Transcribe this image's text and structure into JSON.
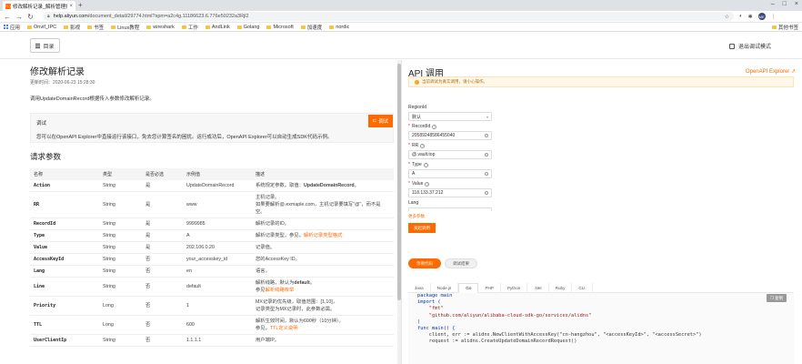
{
  "browser": {
    "tab_title": "修改解析记录_解析管理接",
    "tab_favicon": "C-)",
    "url_host": "help.aliyun.com",
    "url_path": "/document_detail/29774.html?spm=a2c4g.11186623.6.776e50232a3Rjl2",
    "bookmarks": [
      "应用",
      "Onvif_IPC",
      "影视",
      "书签",
      "Linux教程",
      "wireshark",
      "工作",
      "AndLink",
      "Golang",
      "Microsoft",
      "加速度",
      "nordic"
    ],
    "bookmarks_other": "其他书签",
    "avatar": "ME"
  },
  "header": {
    "toc_label": "目录",
    "exit_debug_label": "退出调试模式"
  },
  "doc": {
    "title": "修改解析记录",
    "updated": "更新时间：2020-06-23 15:28:30",
    "description": "调用UpdateDomainRecord根据传入参数修改解析记录。",
    "debug_heading": "调试",
    "debug_body": "您可以在OpenAPI Explorer中直接运行该接口，免去您计算签名的困扰。运行成功后，OpenAPI Explorer可以自动生成SDK代码示例。",
    "debug_button": "调试",
    "params_title": "请求参数",
    "columns": [
      "名称",
      "类型",
      "是否必选",
      "示例值",
      "描述"
    ],
    "rows": [
      {
        "name": "Action",
        "type": "String",
        "required": "是",
        "example": "UpdateDomainRecord",
        "desc_pre": "系统规定参数。取值：",
        "desc_bold": "UpdateDomainRecord",
        "desc_link": "",
        "desc_post": "。"
      },
      {
        "name": "RR",
        "type": "String",
        "required": "是",
        "example": "www",
        "desc_pre": "主机记录。\n如果要解析@.exmaple.com，主机记录要填写\"@\"，而不是空。",
        "desc_bold": "",
        "desc_link": "",
        "desc_post": ""
      },
      {
        "name": "RecordId",
        "type": "String",
        "required": "是",
        "example": "9999985",
        "desc_pre": "解析记录的ID。",
        "desc_bold": "",
        "desc_link": "",
        "desc_post": ""
      },
      {
        "name": "Type",
        "type": "String",
        "required": "是",
        "example": "A",
        "desc_pre": "解析记录类型，参见",
        "desc_bold": "",
        "desc_link": "解析记录类型格式",
        "desc_post": "。"
      },
      {
        "name": "Value",
        "type": "String",
        "required": "是",
        "example": "202.106.0.20",
        "desc_pre": "记录值。",
        "desc_bold": "",
        "desc_link": "",
        "desc_post": ""
      },
      {
        "name": "AccessKeyId",
        "type": "String",
        "required": "否",
        "example": "your_accesskey_id",
        "desc_pre": "您的AccessKey ID。",
        "desc_bold": "",
        "desc_link": "",
        "desc_post": ""
      },
      {
        "name": "Lang",
        "type": "String",
        "required": "否",
        "example": "en",
        "desc_pre": "语言。",
        "desc_bold": "",
        "desc_link": "",
        "desc_post": ""
      },
      {
        "name": "Line",
        "type": "String",
        "required": "否",
        "example": "default",
        "desc_pre": "解析线路，默认为",
        "desc_bold": "default",
        "desc_link": "解析线路枚举",
        "desc_post": "。\n参见"
      },
      {
        "name": "Priority",
        "type": "Long",
        "required": "否",
        "example": "1",
        "desc_pre": "MX记录的优先级，取值范围：[1,10]，\n记录类型为MX记录时，此参数必需。",
        "desc_bold": "",
        "desc_link": "",
        "desc_post": ""
      },
      {
        "name": "TTL",
        "type": "Long",
        "required": "否",
        "example": "600",
        "desc_pre": "解析生效时间，默认为600秒（10分钟）。\n参见",
        "desc_bold": "",
        "desc_link": "TTL定义说明",
        "desc_post": "。"
      },
      {
        "name": "UserClientIp",
        "type": "String",
        "required": "否",
        "example": "1.1.1.1",
        "desc_pre": "用户端IP。",
        "desc_bold": "",
        "desc_link": "",
        "desc_post": ""
      }
    ]
  },
  "api": {
    "title": "API 调用",
    "explorer_link": "OpenAPI Explorer",
    "notice": "当前调试为真实调用，请小心操作。",
    "fields": [
      {
        "label": "RegionId",
        "required": false,
        "value": "默认",
        "kind": "select"
      },
      {
        "label": "RecordId",
        "required": true,
        "value": "20589248586455040",
        "kind": "input"
      },
      {
        "label": "RR",
        "required": true,
        "value": "@.vault.top",
        "kind": "input"
      },
      {
        "label": "Type",
        "required": true,
        "value": "A",
        "kind": "input"
      },
      {
        "label": "Value",
        "required": true,
        "value": "118.133.37.212",
        "kind": "input"
      }
    ],
    "lang_label": "Lang",
    "more_link": "更多参数",
    "start_button": "发起调用",
    "tab_run": "示例代码",
    "tab_result": "调试结果",
    "languages": [
      "Java",
      "Node.js",
      "Go",
      "PHP",
      "Python",
      ".Net",
      "Ruby",
      "CLI"
    ],
    "active_language": "Go",
    "copy_label": "复制",
    "code_lines": [
      "package main",
      "",
      "import (",
      "    \"fmt\"",
      "    \"github.com/aliyun/alibaba-cloud-sdk-go/services/alidns\"",
      ")",
      "",
      "func main() {",
      "    client, err := alidns.NewClientWithAccessKey(\"cn-hangzhou\", \"<accessKeyId>\", \"<accessSecret>\")",
      "",
      "    request := alidns.CreateUpdateDomainRecordRequest()"
    ]
  }
}
